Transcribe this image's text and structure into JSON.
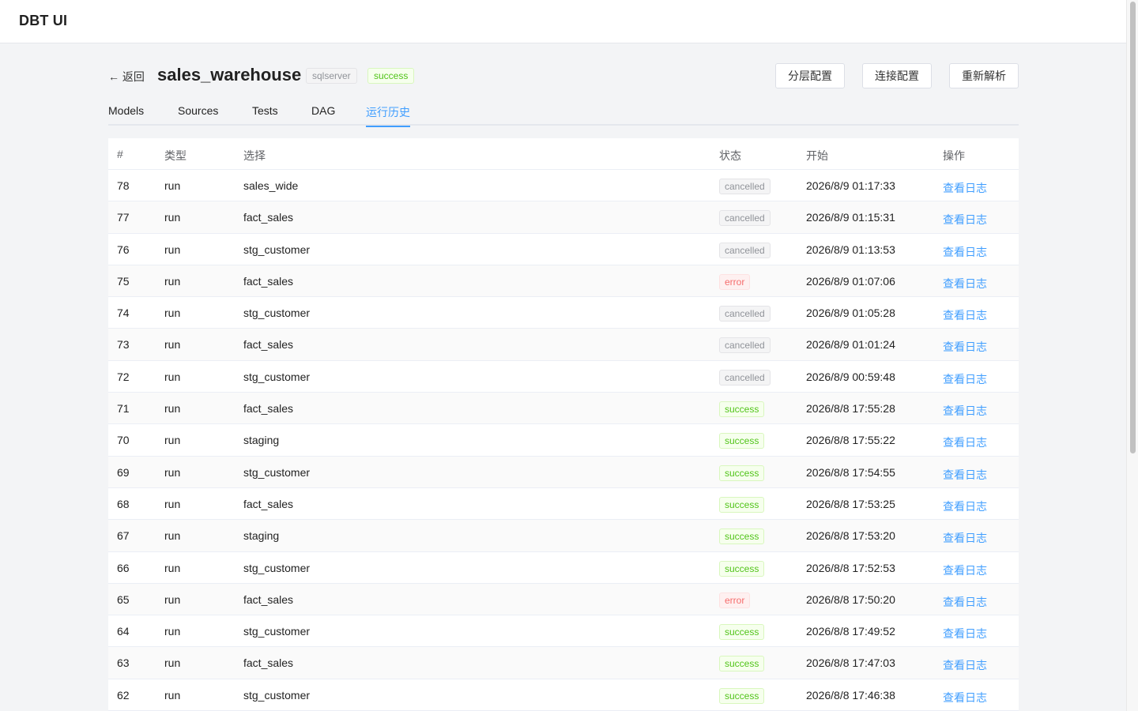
{
  "app": {
    "title": "DBT UI"
  },
  "header": {
    "back_label": "← 返回",
    "project_name": "sales_warehouse",
    "db_type": "sqlserver",
    "status": "success",
    "buttons": {
      "layer_config": "分层配置",
      "connection_config": "连接配置",
      "reparse": "重新解析"
    }
  },
  "tabs": {
    "models": "Models",
    "sources": "Sources",
    "tests": "Tests",
    "dag": "DAG",
    "history": "运行历史"
  },
  "table": {
    "columns": {
      "num": "#",
      "type": "类型",
      "selection": "选择",
      "status": "状态",
      "start": "开始",
      "actions": "操作"
    },
    "view_log_label": "查看日志",
    "rows": [
      {
        "num": "78",
        "type": "run",
        "selection": "sales_wide",
        "status": "cancelled",
        "start": "2026/8/9 01:17:33"
      },
      {
        "num": "77",
        "type": "run",
        "selection": "fact_sales",
        "status": "cancelled",
        "start": "2026/8/9 01:15:31"
      },
      {
        "num": "76",
        "type": "run",
        "selection": "stg_customer",
        "status": "cancelled",
        "start": "2026/8/9 01:13:53"
      },
      {
        "num": "75",
        "type": "run",
        "selection": "fact_sales",
        "status": "error",
        "start": "2026/8/9 01:07:06"
      },
      {
        "num": "74",
        "type": "run",
        "selection": "stg_customer",
        "status": "cancelled",
        "start": "2026/8/9 01:05:28"
      },
      {
        "num": "73",
        "type": "run",
        "selection": "fact_sales",
        "status": "cancelled",
        "start": "2026/8/9 01:01:24"
      },
      {
        "num": "72",
        "type": "run",
        "selection": "stg_customer",
        "status": "cancelled",
        "start": "2026/8/9 00:59:48"
      },
      {
        "num": "71",
        "type": "run",
        "selection": "fact_sales",
        "status": "success",
        "start": "2026/8/8 17:55:28"
      },
      {
        "num": "70",
        "type": "run",
        "selection": "staging",
        "status": "success",
        "start": "2026/8/8 17:55:22"
      },
      {
        "num": "69",
        "type": "run",
        "selection": "stg_customer",
        "status": "success",
        "start": "2026/8/8 17:54:55"
      },
      {
        "num": "68",
        "type": "run",
        "selection": "fact_sales",
        "status": "success",
        "start": "2026/8/8 17:53:25"
      },
      {
        "num": "67",
        "type": "run",
        "selection": "staging",
        "status": "success",
        "start": "2026/8/8 17:53:20"
      },
      {
        "num": "66",
        "type": "run",
        "selection": "stg_customer",
        "status": "success",
        "start": "2026/8/8 17:52:53"
      },
      {
        "num": "65",
        "type": "run",
        "selection": "fact_sales",
        "status": "error",
        "start": "2026/8/8 17:50:20"
      },
      {
        "num": "64",
        "type": "run",
        "selection": "stg_customer",
        "status": "success",
        "start": "2026/8/8 17:49:52"
      },
      {
        "num": "63",
        "type": "run",
        "selection": "fact_sales",
        "status": "success",
        "start": "2026/8/8 17:47:03"
      },
      {
        "num": "62",
        "type": "run",
        "selection": "stg_customer",
        "status": "success",
        "start": "2026/8/8 17:46:38"
      }
    ]
  },
  "colors": {
    "accent": "#409eff",
    "success": "#52c41a",
    "error": "#f56c6c",
    "cancelled": "#909399"
  }
}
